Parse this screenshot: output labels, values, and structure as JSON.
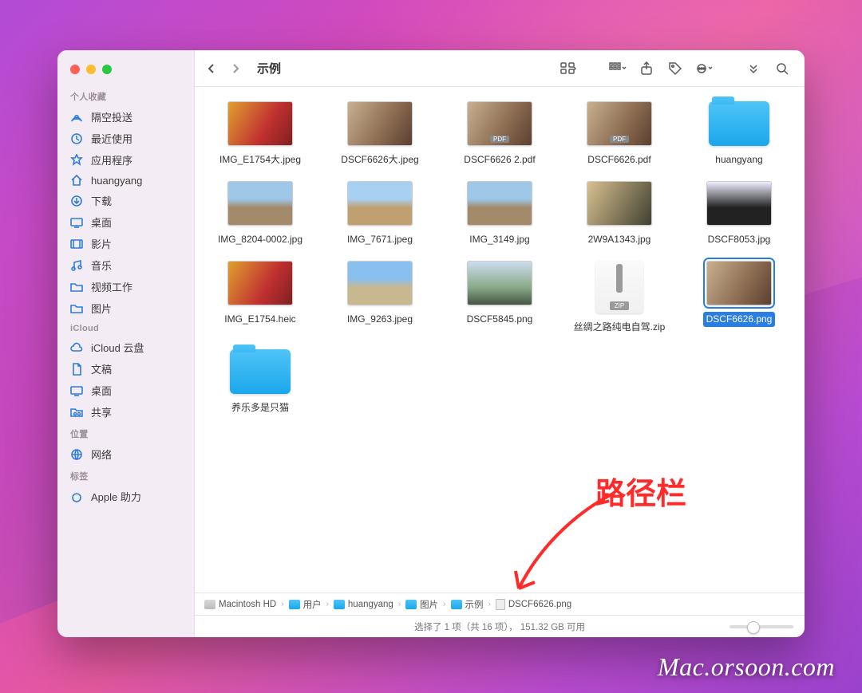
{
  "window_title": "示例",
  "sidebar": {
    "sections": [
      {
        "label": "个人收藏",
        "items": [
          {
            "icon": "airdrop",
            "label": "隔空投送"
          },
          {
            "icon": "clock",
            "label": "最近使用"
          },
          {
            "icon": "apps",
            "label": "应用程序"
          },
          {
            "icon": "home",
            "label": "huangyang"
          },
          {
            "icon": "download",
            "label": "下载"
          },
          {
            "icon": "desktop",
            "label": "桌面"
          },
          {
            "icon": "movie",
            "label": "影片"
          },
          {
            "icon": "music",
            "label": "音乐"
          },
          {
            "icon": "folder",
            "label": "视频工作"
          },
          {
            "icon": "folder",
            "label": "图片"
          }
        ]
      },
      {
        "label": "iCloud",
        "items": [
          {
            "icon": "cloud",
            "label": "iCloud 云盘"
          },
          {
            "icon": "doc",
            "label": "文稿"
          },
          {
            "icon": "desktop",
            "label": "桌面"
          },
          {
            "icon": "share",
            "label": "共享"
          }
        ]
      },
      {
        "label": "位置",
        "items": [
          {
            "icon": "globe",
            "label": "网络"
          }
        ]
      },
      {
        "label": "标签",
        "items": [
          {
            "icon": "apple",
            "label": "Apple 助力"
          }
        ]
      }
    ]
  },
  "files": [
    {
      "name": "IMG_E1754大.jpeg",
      "kind": "img",
      "bg": "bg-a"
    },
    {
      "name": "DSCF6626大.jpeg",
      "kind": "img",
      "bg": "bg-b"
    },
    {
      "name": "DSCF6626 2.pdf",
      "kind": "pdf",
      "bg": "bg-b"
    },
    {
      "name": "DSCF6626.pdf",
      "kind": "pdf",
      "bg": "bg-b"
    },
    {
      "name": "huangyang",
      "kind": "folder"
    },
    {
      "name": "IMG_8204-0002.jpg",
      "kind": "img",
      "bg": "bg-c"
    },
    {
      "name": "IMG_7671.jpeg",
      "kind": "img",
      "bg": "bg-g"
    },
    {
      "name": "IMG_3149.jpg",
      "kind": "img",
      "bg": "bg-c"
    },
    {
      "name": "2W9A1343.jpg",
      "kind": "img",
      "bg": "bg-f"
    },
    {
      "name": "DSCF8053.jpg",
      "kind": "img",
      "bg": "bg-e"
    },
    {
      "name": "IMG_E1754.heic",
      "kind": "img",
      "bg": "bg-a"
    },
    {
      "name": "IMG_9263.jpeg",
      "kind": "img",
      "bg": "bg-h"
    },
    {
      "name": "DSCF5845.png",
      "kind": "img",
      "bg": "bg-d"
    },
    {
      "name": "丝绸之路纯电自驾.zip",
      "kind": "zip"
    },
    {
      "name": "DSCF6626.png",
      "kind": "img",
      "bg": "bg-b",
      "selected": true
    },
    {
      "name": "养乐多是只猫",
      "kind": "folder"
    }
  ],
  "path": [
    {
      "icon": "disk",
      "label": "Macintosh HD"
    },
    {
      "icon": "folder",
      "label": "用户"
    },
    {
      "icon": "folder",
      "label": "huangyang"
    },
    {
      "icon": "folder",
      "label": "图片"
    },
    {
      "icon": "folder",
      "label": "示例"
    },
    {
      "icon": "file",
      "label": "DSCF6626.png"
    }
  ],
  "status_text": "选择了 1 项（共 16 项），  151.32 GB 可用",
  "annotation": "路径栏",
  "watermark": "Mac.orsoon.com"
}
